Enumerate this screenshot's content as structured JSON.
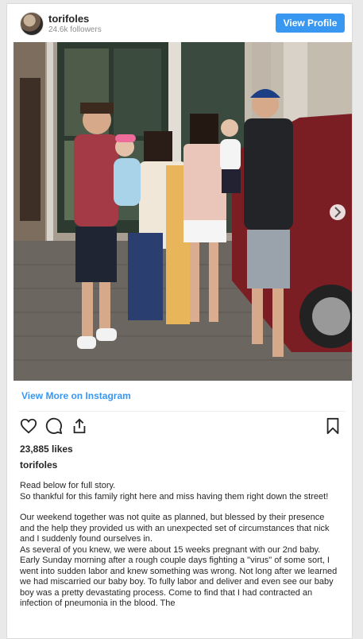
{
  "header": {
    "username": "torifoles",
    "followers": "24.6k followers",
    "view_profile_label": "View Profile"
  },
  "post": {
    "view_more_label": "View More on Instagram",
    "likes": "23,885 likes",
    "owner": "torifoles",
    "caption_lines": [
      "Read below for full story.",
      "So thankful for this family right here and miss having them right down the street!",
      "",
      "Our weekend together was not quite as planned, but blessed by their presence and the help they provided us with an unexpected set of circumstances that nick and I suddenly found ourselves in.",
      "As several of you knew, we were about 15 weeks pregnant with our 2nd baby. Early Sunday morning after a rough couple days fighting a \"virus\" of some sort, I went into sudden labor and knew something was wrong. Not long after we learned we had miscarried our baby boy. To fully labor and deliver and even see our baby boy was a pretty devastating process. Come to find that I had contracted an infection of pneumonia in the blood. The"
    ]
  },
  "icons": {
    "like": "heart-icon",
    "comment": "comment-icon",
    "share": "share-icon",
    "save": "bookmark-icon",
    "carousel_next": "chevron-right-icon"
  },
  "colors": {
    "accent": "#3897f0",
    "text": "#262626",
    "muted": "#8e8e8e"
  }
}
